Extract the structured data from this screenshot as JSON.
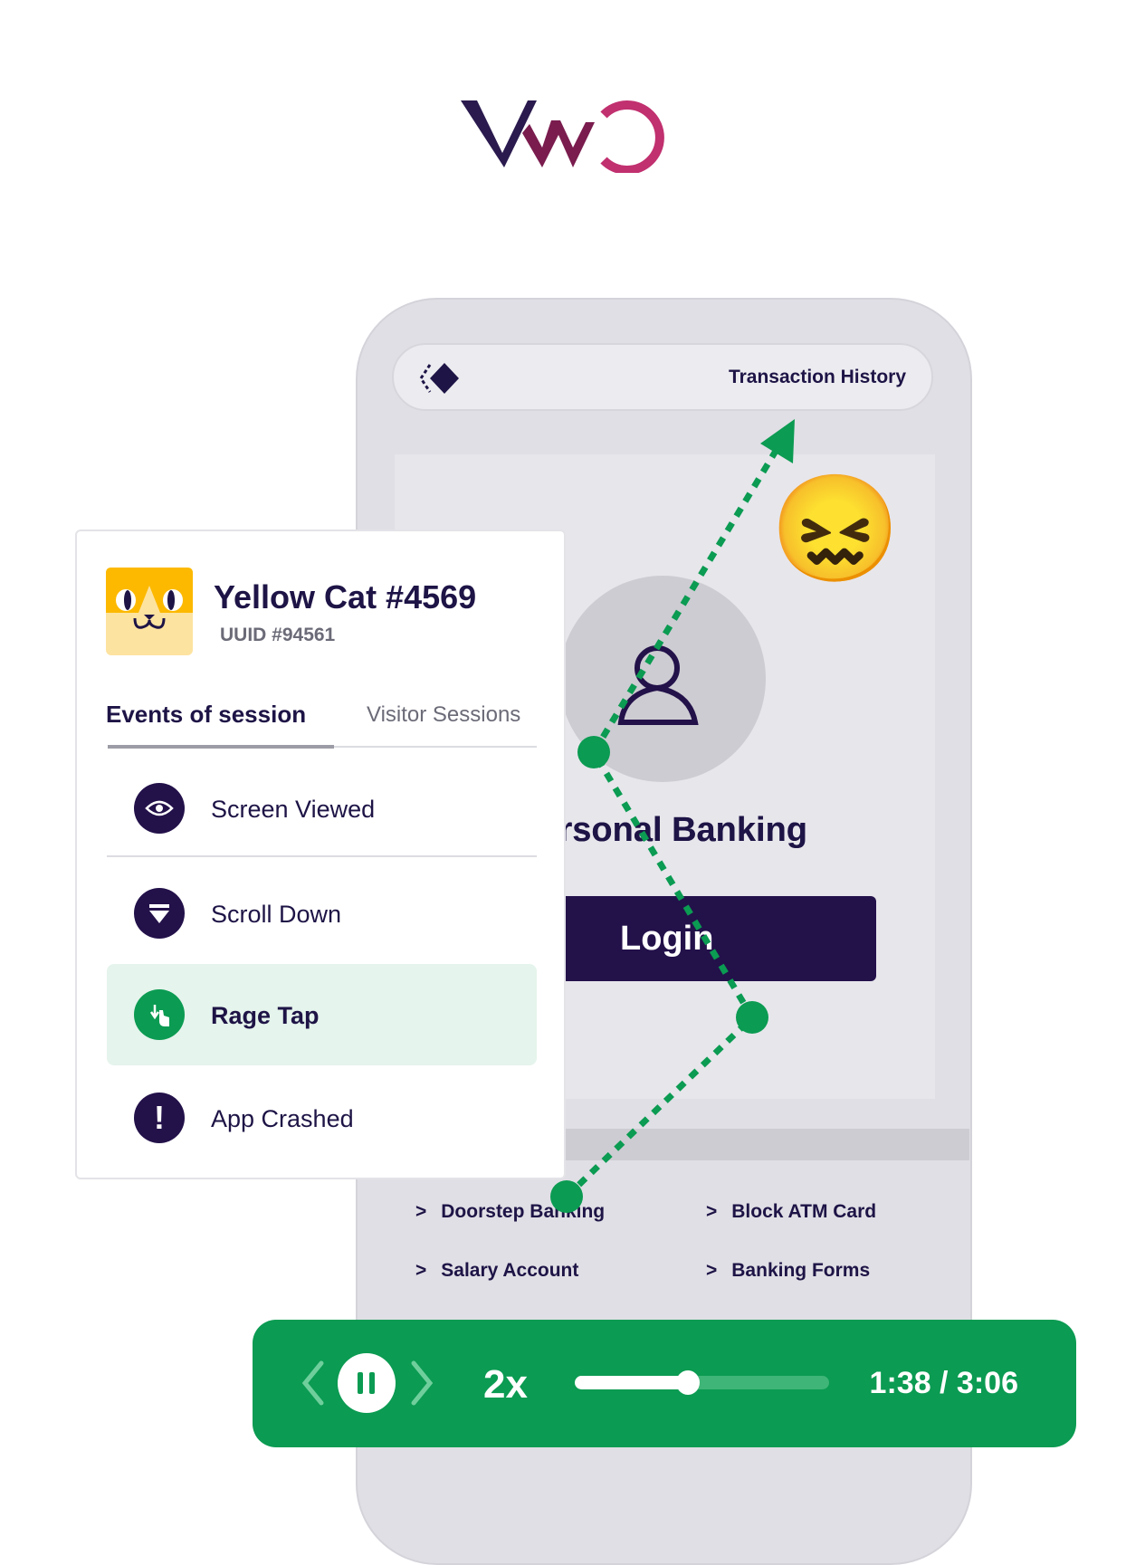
{
  "logo": {
    "text": "VWO",
    "colors": [
      "#2a1a4e",
      "#7a1c4e",
      "#c1306f"
    ]
  },
  "phone": {
    "header_title": "Transaction History",
    "header_icon": "vwo-insights-icon",
    "screen_title": "Personal Banking",
    "screen_title_visible": "rsonal Banking",
    "login_label": "Login",
    "links": [
      {
        "label": "Doorstep Banking"
      },
      {
        "label": "Block ATM Card"
      },
      {
        "label": "Salary Account"
      },
      {
        "label": "Banking Forms"
      }
    ],
    "link_chevron": ">",
    "emoji": "😖"
  },
  "panel": {
    "visitor_name": "Yellow Cat #4569",
    "uuid": "UUID #94561",
    "tabs": [
      {
        "label": "Events of session",
        "active": true
      },
      {
        "label": "Visitor Sessions",
        "active": false
      }
    ],
    "events": [
      {
        "label": "Screen Viewed",
        "icon": "eye-icon"
      },
      {
        "label": "Scroll Down",
        "icon": "scroll-down-icon"
      },
      {
        "label": "Rage Tap",
        "icon": "tap-icon",
        "highlighted": true
      },
      {
        "label": "App Crashed",
        "icon": "exclamation-icon"
      }
    ]
  },
  "player": {
    "speed": "2x",
    "time": "1:38 / 3:06",
    "progress": 0.445,
    "accent": "#0b9b52"
  }
}
